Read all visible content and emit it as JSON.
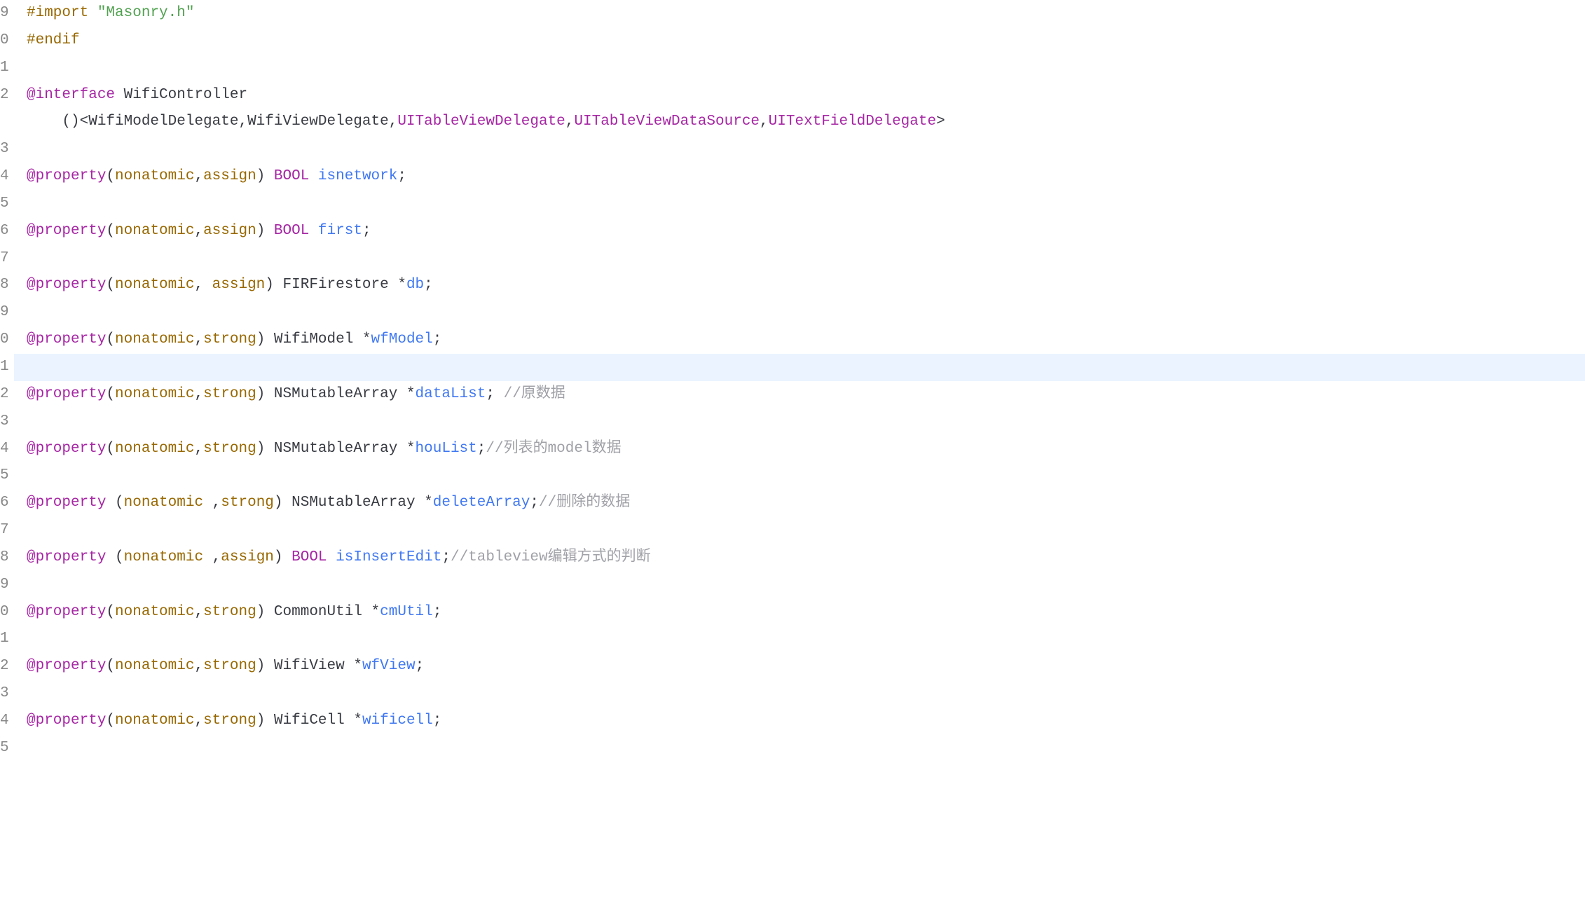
{
  "lineNumbers": [
    "9",
    "0",
    "1",
    "2",
    "",
    "3",
    "4",
    "5",
    "6",
    "7",
    "8",
    "9",
    "0",
    "1",
    "2",
    "3",
    "4",
    "5",
    "6",
    "7",
    "8",
    "9",
    "0",
    "1",
    "2",
    "3",
    "4",
    "5"
  ],
  "code": {
    "l1": {
      "directive": "#import",
      "string": "\"Masonry.h\""
    },
    "l2": {
      "directive": "#endif"
    },
    "l4": {
      "at": "@interface",
      "name": " WifiController"
    },
    "l5": {
      "open": "    ()<",
      "p1": "WifiModelDelegate",
      "c1": ",",
      "p2": "WifiViewDelegate",
      "c2": ",",
      "p3": "UITableViewDelegate",
      "c3": ",",
      "p4": "UITableViewDataSource",
      "c4": ",",
      "p5": "UITextFieldDelegate",
      "close": ">"
    },
    "l7": {
      "at": "@property",
      "open": "(",
      "a1": "nonatomic",
      "c1": ",",
      "a2": "assign",
      "close": ") ",
      "type": "BOOL",
      "name": " isnetwork",
      "semi": ";"
    },
    "l9": {
      "at": "@property",
      "open": "(",
      "a1": "nonatomic",
      "c1": ",",
      "a2": "assign",
      "close": ") ",
      "type": "BOOL",
      "name": " first",
      "semi": ";"
    },
    "l11": {
      "at": "@property",
      "open": "(",
      "a1": "nonatomic",
      "c1": ", ",
      "a2": "assign",
      "close": ") ",
      "type": "FIRFirestore *",
      "name": "db",
      "semi": ";"
    },
    "l13": {
      "at": "@property",
      "open": "(",
      "a1": "nonatomic",
      "c1": ",",
      "a2": "strong",
      "close": ") ",
      "type": "WifiModel *",
      "name": "wfModel",
      "semi": ";"
    },
    "l15": {
      "at": "@property",
      "open": "(",
      "a1": "nonatomic",
      "c1": ",",
      "a2": "strong",
      "close": ") ",
      "type": "NSMutableArray *",
      "name": "dataList",
      "semi": "; ",
      "comment": "//原数据"
    },
    "l17": {
      "at": "@property",
      "open": "(",
      "a1": "nonatomic",
      "c1": ",",
      "a2": "strong",
      "close": ") ",
      "type": "NSMutableArray *",
      "name": "houList",
      "semi": ";",
      "comment": "//列表的model数据"
    },
    "l19": {
      "at": "@property",
      "open": " (",
      "a1": "nonatomic",
      "c1": " ,",
      "a2": "strong",
      "close": ") ",
      "type": "NSMutableArray *",
      "name": "deleteArray",
      "semi": ";",
      "comment": "//删除的数据"
    },
    "l21": {
      "at": "@property",
      "open": " (",
      "a1": "nonatomic",
      "c1": " ,",
      "a2": "assign",
      "close": ") ",
      "type": "BOOL",
      "name": " isInsertEdit",
      "semi": ";",
      "comment": "//tableview编辑方式的判断"
    },
    "l23": {
      "at": "@property",
      "open": "(",
      "a1": "nonatomic",
      "c1": ",",
      "a2": "strong",
      "close": ") ",
      "type": "CommonUtil *",
      "name": "cmUtil",
      "semi": ";"
    },
    "l25": {
      "at": "@property",
      "open": "(",
      "a1": "nonatomic",
      "c1": ",",
      "a2": "strong",
      "close": ") ",
      "type": "WifiView *",
      "name": "wfView",
      "semi": ";"
    },
    "l27": {
      "at": "@property",
      "open": "(",
      "a1": "nonatomic",
      "c1": ",",
      "a2": "strong",
      "close": ") ",
      "type": "WifiCell *",
      "name": "wificell",
      "semi": ";"
    }
  }
}
